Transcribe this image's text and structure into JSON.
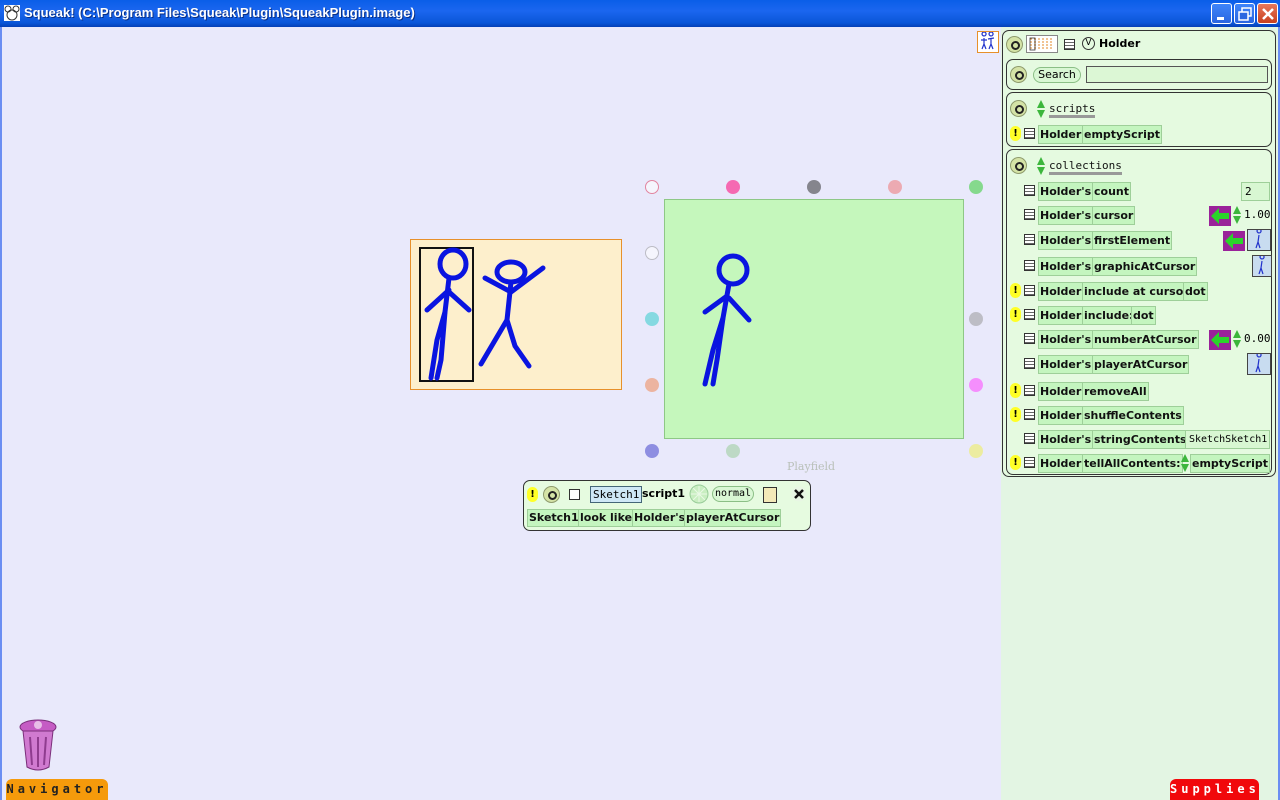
{
  "window": {
    "title": "Squeak! (C:\\Program Files\\Squeak\\Plugin\\SqueakPlugin.image)"
  },
  "world": {
    "playfield_label": "Playfield",
    "navigator_label": "Navigator",
    "supplies_label": "Supplies"
  },
  "script_editor": {
    "player_name": "Sketch1",
    "script_name": "script1",
    "tick_mode": "normal",
    "tiles": [
      "Sketch1",
      "look like",
      "Holder's",
      "playerAtCursor"
    ]
  },
  "viewer": {
    "player_name": "Holder",
    "v_label": "V",
    "search_label": "Search",
    "search_value": "",
    "categories": [
      {
        "name": "scripts",
        "rows": [
          {
            "kind": "command",
            "parts": [
              "Holder",
              "emptyScript"
            ]
          }
        ]
      },
      {
        "name": "collections",
        "rows": [
          {
            "kind": "getter",
            "parts": [
              "Holder's",
              "count"
            ],
            "value": "2"
          },
          {
            "kind": "getter",
            "parts": [
              "Holder's",
              "cursor"
            ],
            "value": "1.00"
          },
          {
            "kind": "getter",
            "parts": [
              "Holder's",
              "firstElement"
            ],
            "value": ""
          },
          {
            "kind": "getter",
            "parts": [
              "Holder's",
              "graphicAtCursor"
            ],
            "value": ""
          },
          {
            "kind": "command",
            "parts": [
              "Holder",
              "include at cursor",
              "dot"
            ]
          },
          {
            "kind": "command",
            "parts": [
              "Holder",
              "include:",
              "dot"
            ]
          },
          {
            "kind": "getter",
            "parts": [
              "Holder's",
              "numberAtCursor"
            ],
            "value": "0.00"
          },
          {
            "kind": "getter",
            "parts": [
              "Holder's",
              "playerAtCursor"
            ],
            "value": ""
          },
          {
            "kind": "command",
            "parts": [
              "Holder",
              "removeAll"
            ]
          },
          {
            "kind": "command",
            "parts": [
              "Holder",
              "shuffleContents"
            ]
          },
          {
            "kind": "getter",
            "parts": [
              "Holder's",
              "stringContents"
            ],
            "value": "SketchSketch1"
          },
          {
            "kind": "command",
            "parts": [
              "Holder",
              "tellAllContents:",
              "emptyScript"
            ]
          }
        ]
      }
    ]
  },
  "colors": {
    "world_bg": "#e9e9fb",
    "playfield_bg": "#c5f7bc",
    "holder_bg": "#fdefcc",
    "stick_figure": "#0a14e0",
    "tile_bg": "#c4f5bf",
    "arrow_purple": "#9a229a",
    "arrow_green": "#2bd42b"
  }
}
